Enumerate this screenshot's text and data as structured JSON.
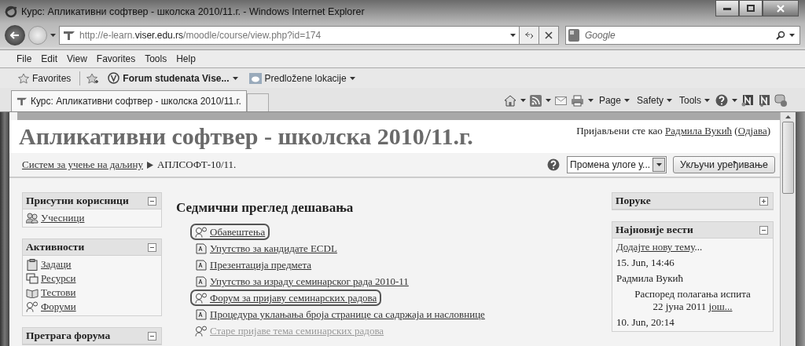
{
  "window": {
    "title": "Курс: Апликативни софтвер - школска 2010/11.г. - Windows Internet Explorer"
  },
  "address_bar": {
    "url": "http://e-learn.**viser.edu.rs**/moodle/course/view.php?id=174"
  },
  "search": {
    "placeholder": "Google"
  },
  "menu": [
    "File",
    "Edit",
    "View",
    "Favorites",
    "Tools",
    "Help"
  ],
  "favorites_bar": {
    "favorites_label": "Favorites",
    "links": [
      {
        "label": "Forum studenata Vise...",
        "kind": "site"
      },
      {
        "label": "Predložene lokacije",
        "kind": "suggested"
      }
    ]
  },
  "tabs": [
    {
      "label": "Курс: Апликативни софтвер - школска 2010/11.г.",
      "selected": true
    }
  ],
  "command_bar": {
    "menus": [
      "Page",
      "Safety",
      "Tools"
    ]
  },
  "page": {
    "course_title": "Апликативни софтвер - школска 2010/11.г.",
    "login_text": "Пријављени сте као",
    "user": "Радмила Вукић",
    "paren_open": "(",
    "logout": "Одјава",
    "paren_close": ")",
    "breadcrumb": [
      {
        "label": "Систем за учење на даљину",
        "link": true
      },
      {
        "label": "АПЛСОФТ-10/11.",
        "link": false
      }
    ],
    "role_select": "Промена улоге у...",
    "edit_button": "Укључи уређивање"
  },
  "left_blocks": [
    {
      "title": "Присутни корисници",
      "expanded": true,
      "items": [
        {
          "label": "Учесници",
          "kind": "people"
        }
      ]
    },
    {
      "title": "Активности",
      "expanded": true,
      "items": [
        {
          "label": "Задаци",
          "kind": "assignment"
        },
        {
          "label": "Ресурси",
          "kind": "resource"
        },
        {
          "label": "Тестови",
          "kind": "quiz"
        },
        {
          "label": "Форуми",
          "kind": "forum"
        }
      ]
    },
    {
      "title": "Претрага форума",
      "expanded": true
    }
  ],
  "section": {
    "title": "Седмични преглед дешавања",
    "items": [
      {
        "label": "Обавештења",
        "kind": "forum",
        "highlighted": true,
        "dimmed": false
      },
      {
        "label": "Упутство за кандидате ECDL",
        "kind": "resource",
        "highlighted": false,
        "dimmed": false
      },
      {
        "label": "Презентација предмета",
        "kind": "resource",
        "highlighted": false,
        "dimmed": false
      },
      {
        "label": "Упутство за израду семинарског рада 2010-11",
        "kind": "resource",
        "highlighted": false,
        "dimmed": false
      },
      {
        "label": "Форум за пријаву семинарских радова",
        "kind": "forum",
        "highlighted": true,
        "dimmed": false
      },
      {
        "label": "Процедура уклањања броја странице са садржаја и насловнице",
        "kind": "resource",
        "highlighted": false,
        "dimmed": false
      },
      {
        "label": "Старе пријаве тема семинарских радова",
        "kind": "forum",
        "highlighted": false,
        "dimmed": true
      }
    ]
  },
  "right_blocks": [
    {
      "title": "Поруке",
      "expanded": false
    },
    {
      "title": "Најновије вести",
      "expanded": true,
      "add_link": "Додајте нову тему",
      "add_suffix": "...",
      "news": [
        {
          "date": "15. Jun, 14:46",
          "author": "Радмила Вукић",
          "text": "Распоред полагања испита 22 јуна 2011",
          "more": "још..."
        },
        {
          "date": "10. Jun, 20:14"
        }
      ]
    }
  ]
}
